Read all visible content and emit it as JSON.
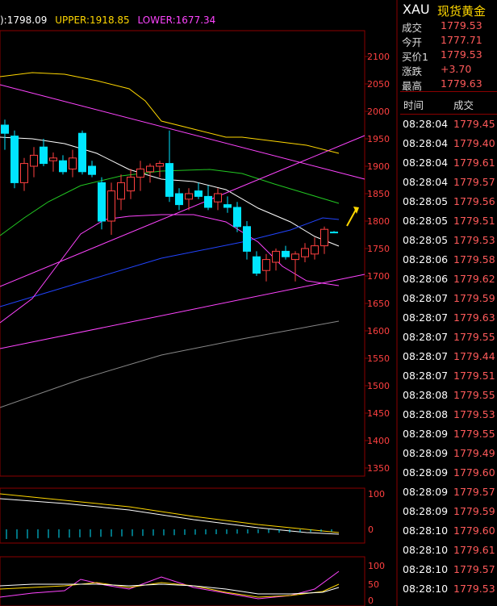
{
  "header": {
    "ma_label": "):1798.09",
    "upper_label": "UPPER:1918.85",
    "lower_label": "LOWER:1677.34"
  },
  "colors": {
    "upper": "#ffd700",
    "lower": "#ff44ff",
    "up_candle": "#ff4040",
    "down_candle": "#00e5ff",
    "frame": "#8b0000",
    "price_red": "#ff5a5a"
  },
  "axis": {
    "main_ticks": [
      "2100",
      "2050",
      "2000",
      "1950",
      "1900",
      "1850",
      "1800",
      "1750",
      "1700",
      "1650",
      "1600",
      "1550",
      "1500",
      "1450",
      "1400",
      "1350"
    ],
    "macd_ticks": [
      "100",
      "0"
    ],
    "kdj_ticks": [
      "100",
      "50",
      "0"
    ]
  },
  "quote": {
    "symbol": "XAU",
    "name": "现货黄金",
    "rows": [
      {
        "label": "成交",
        "value": "1779.53"
      },
      {
        "label": "今开",
        "value": "1777.71"
      },
      {
        "label": "买价1",
        "value": "1779.53"
      },
      {
        "label": "涨跌",
        "value": "+3.70"
      },
      {
        "label": "最高",
        "value": "1779.63"
      }
    ]
  },
  "ticks_header": {
    "time": "时间",
    "trade": "成交"
  },
  "ticks": [
    {
      "time": "08:28:04",
      "price": "1779.45"
    },
    {
      "time": "08:28:04",
      "price": "1779.40"
    },
    {
      "time": "08:28:04",
      "price": "1779.61"
    },
    {
      "time": "08:28:04",
      "price": "1779.57"
    },
    {
      "time": "08:28:05",
      "price": "1779.56"
    },
    {
      "time": "08:28:05",
      "price": "1779.51"
    },
    {
      "time": "08:28:05",
      "price": "1779.53"
    },
    {
      "time": "08:28:06",
      "price": "1779.58"
    },
    {
      "time": "08:28:06",
      "price": "1779.62"
    },
    {
      "time": "08:28:07",
      "price": "1779.59"
    },
    {
      "time": "08:28:07",
      "price": "1779.63"
    },
    {
      "time": "08:28:07",
      "price": "1779.55"
    },
    {
      "time": "08:28:07",
      "price": "1779.44"
    },
    {
      "time": "08:28:07",
      "price": "1779.51"
    },
    {
      "time": "08:28:08",
      "price": "1779.55"
    },
    {
      "time": "08:28:08",
      "price": "1779.53"
    },
    {
      "time": "08:28:09",
      "price": "1779.55"
    },
    {
      "time": "08:28:09",
      "price": "1779.49"
    },
    {
      "time": "08:28:09",
      "price": "1779.60"
    },
    {
      "time": "08:28:09",
      "price": "1779.57"
    },
    {
      "time": "08:28:09",
      "price": "1779.59"
    },
    {
      "time": "08:28:10",
      "price": "1779.60"
    },
    {
      "time": "08:28:10",
      "price": "1779.61"
    },
    {
      "time": "08:28:10",
      "price": "1779.57"
    },
    {
      "time": "08:28:10",
      "price": "1779.53"
    }
  ],
  "candles": [
    {
      "o": 1975,
      "h": 1985,
      "l": 1930,
      "c": 1960
    },
    {
      "o": 1955,
      "h": 1965,
      "l": 1860,
      "c": 1870
    },
    {
      "o": 1870,
      "h": 1915,
      "l": 1855,
      "c": 1905
    },
    {
      "o": 1900,
      "h": 1935,
      "l": 1880,
      "c": 1920
    },
    {
      "o": 1935,
      "h": 1950,
      "l": 1900,
      "c": 1905
    },
    {
      "o": 1910,
      "h": 1925,
      "l": 1890,
      "c": 1915
    },
    {
      "o": 1910,
      "h": 1920,
      "l": 1885,
      "c": 1890
    },
    {
      "o": 1895,
      "h": 1930,
      "l": 1880,
      "c": 1915
    },
    {
      "o": 1960,
      "h": 1965,
      "l": 1885,
      "c": 1890
    },
    {
      "o": 1900,
      "h": 1910,
      "l": 1880,
      "c": 1885
    },
    {
      "o": 1870,
      "h": 1880,
      "l": 1785,
      "c": 1800
    },
    {
      "o": 1800,
      "h": 1870,
      "l": 1775,
      "c": 1855
    },
    {
      "o": 1840,
      "h": 1885,
      "l": 1820,
      "c": 1870
    },
    {
      "o": 1855,
      "h": 1895,
      "l": 1840,
      "c": 1880
    },
    {
      "o": 1880,
      "h": 1910,
      "l": 1855,
      "c": 1895
    },
    {
      "o": 1890,
      "h": 1905,
      "l": 1870,
      "c": 1900
    },
    {
      "o": 1900,
      "h": 1910,
      "l": 1880,
      "c": 1905
    },
    {
      "o": 1905,
      "h": 1965,
      "l": 1835,
      "c": 1845
    },
    {
      "o": 1850,
      "h": 1860,
      "l": 1820,
      "c": 1830
    },
    {
      "o": 1840,
      "h": 1860,
      "l": 1820,
      "c": 1850
    },
    {
      "o": 1855,
      "h": 1870,
      "l": 1840,
      "c": 1845
    },
    {
      "o": 1845,
      "h": 1865,
      "l": 1820,
      "c": 1825
    },
    {
      "o": 1835,
      "h": 1860,
      "l": 1820,
      "c": 1850
    },
    {
      "o": 1830,
      "h": 1845,
      "l": 1815,
      "c": 1825
    },
    {
      "o": 1825,
      "h": 1835,
      "l": 1780,
      "c": 1790
    },
    {
      "o": 1790,
      "h": 1800,
      "l": 1730,
      "c": 1745
    },
    {
      "o": 1735,
      "h": 1745,
      "l": 1700,
      "c": 1705
    },
    {
      "o": 1710,
      "h": 1740,
      "l": 1690,
      "c": 1730
    },
    {
      "o": 1725,
      "h": 1750,
      "l": 1710,
      "c": 1745
    },
    {
      "o": 1745,
      "h": 1755,
      "l": 1730,
      "c": 1735
    },
    {
      "o": 1730,
      "h": 1745,
      "l": 1690,
      "c": 1740
    },
    {
      "o": 1735,
      "h": 1760,
      "l": 1725,
      "c": 1750
    },
    {
      "o": 1740,
      "h": 1770,
      "l": 1730,
      "c": 1755
    },
    {
      "o": 1755,
      "h": 1790,
      "l": 1740,
      "c": 1785
    },
    {
      "o": 1780,
      "h": 1782,
      "l": 1778,
      "c": 1779.53
    }
  ]
}
